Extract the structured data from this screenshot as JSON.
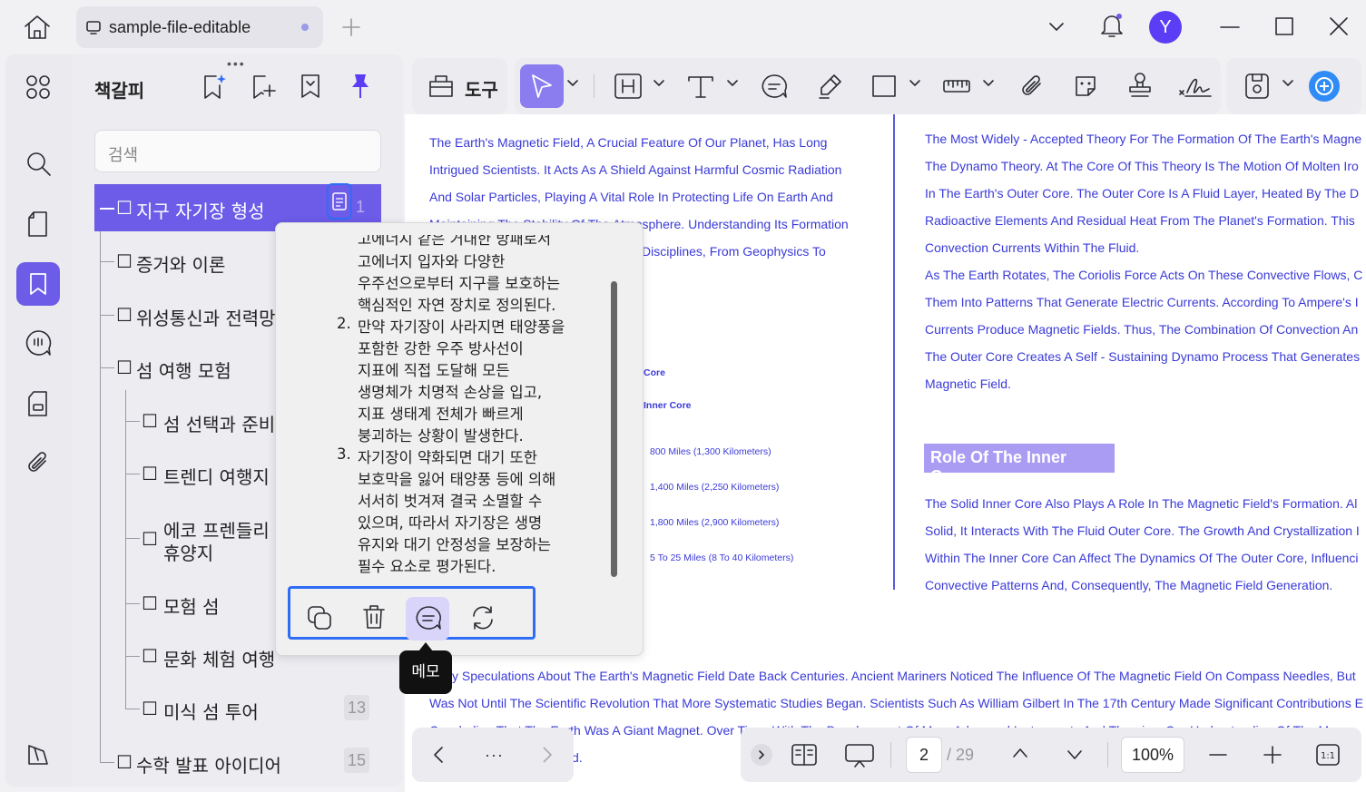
{
  "window": {
    "tab_title": "sample-file-editable",
    "avatar_letter": "Y"
  },
  "sidebar": {
    "title": "책갈피",
    "search_placeholder": "검색",
    "bookmarks": [
      {
        "label": "지구 자기장 형성",
        "page": "1"
      },
      {
        "label": "증거와 이론",
        "page": ""
      },
      {
        "label": "위성통신과 전력망",
        "page": ""
      },
      {
        "label": "섬 여행 모험",
        "page": ""
      },
      {
        "label": "섬 선택과 준비",
        "page": ""
      },
      {
        "label": "트렌디 여행지",
        "page": ""
      },
      {
        "label": "에코 프렌들리",
        "label2": "휴양지",
        "page": ""
      },
      {
        "label": "모험 섬",
        "page": ""
      },
      {
        "label": "문화 체험 여행",
        "page": ""
      },
      {
        "label": "미식 섬 투어",
        "page": "13"
      },
      {
        "label": "수학 발표 아이디어",
        "page": "15"
      }
    ]
  },
  "toolbar": {
    "tools_label": "도구"
  },
  "memo_popup": {
    "lines": [
      "고에너지 입자와 다양한",
      "우주선으로부터 지구를 보호하는",
      "핵심적인 자연 장치로 정의된다.",
      "만약 자기장이 사라지면 태양풍을",
      "포함한 강한 우주 방사선이",
      "지표에 직접 도달해 모든",
      "생명체가 치명적 손상을 입고,",
      "지표 생태계 전체가 빠르게",
      "붕괴하는 상황이 발생한다.",
      "자기장이 약화되면 대기 또한",
      "보호막을 잃어 태양풍 등에 의해",
      "서서히 벗겨져 결국 소멸할 수",
      "있으며, 따라서 자기장은 생명",
      "유지와 대기 안정성을 보장하는",
      "필수 요소로 평가된다."
    ],
    "num2": "2.",
    "num3": "3.",
    "tooltip": "메모"
  },
  "document": {
    "left_col": [
      "The Earth's Magnetic Field, A Crucial Feature Of Our Planet, Has Long",
      "Intrigued Scientists. It Acts As A Shield Against Harmful Cosmic Radiation",
      "And Solar Particles, Playing A Vital Role In Protecting Life On Earth And",
      "Maintaining The Stability Of The Atmosphere. Understanding Its Formation",
      "Disciplines, From Geophysics To"
    ],
    "diagram_labels": [
      "Core",
      "Inner Core",
      "800 Miles (1,300 Kilometers)",
      "1,400 Miles (2,250 Kilometers)",
      "1,800 Miles (2,900 Kilometers)",
      "5 To 25 Miles (8 To 40 Kilometers)"
    ],
    "right_col": [
      "The Most Widely - Accepted Theory For The Formation Of The Earth's Magne",
      "The Dynamo Theory. At The Core Of This Theory Is The Motion Of Molten Iro",
      "In The Earth's Outer Core. The Outer Core Is A Fluid Layer, Heated By The D",
      "Radioactive Elements And Residual Heat From The Planet's Formation. This",
      "Convection Currents Within The Fluid.",
      "As The Earth Rotates, The Coriolis Force Acts On These Convective Flows, C",
      "Them Into Patterns That Generate Electric Currents. According To Ampere's I",
      "Currents Produce Magnetic Fields. Thus, The Combination Of Convection An",
      "The Outer Core Creates A Self - Sustaining Dynamo Process That Generates",
      "Magnetic Field."
    ],
    "heading": "Role Of The Inner Core",
    "right_col2": [
      "The Solid Inner Core Also Plays A Role In The Magnetic Field's Formation. Al",
      "Solid, It Interacts With The Fluid Outer Core. The Growth And Crystallization I",
      "Within The Inner Core Can Affect The Dynamics Of The Outer Core, Influenci",
      "Convective Patterns And, Consequently, The Magnetic Field Generation."
    ],
    "bottom": [
      "y Speculations About The Earth's Magnetic Field Date Back Centuries. Ancient Mariners Noticed The Influence Of The Magnetic Field On Compass Needles, But",
      "Was Not Until The Scientific Revolution That More Systematic Studies Began. Scientists Such As William Gilbert In The 17th Century Made Significant Contributions E",
      "Concluding That The Earth Was A Giant Magnet. Over Time, With The Development Of More Advanced Instruments And Theories, Our Understanding Of The Magne",
      "d."
    ]
  },
  "pager": {
    "current_page": "2",
    "total_pages": "/ 29",
    "zoom": "100%"
  }
}
